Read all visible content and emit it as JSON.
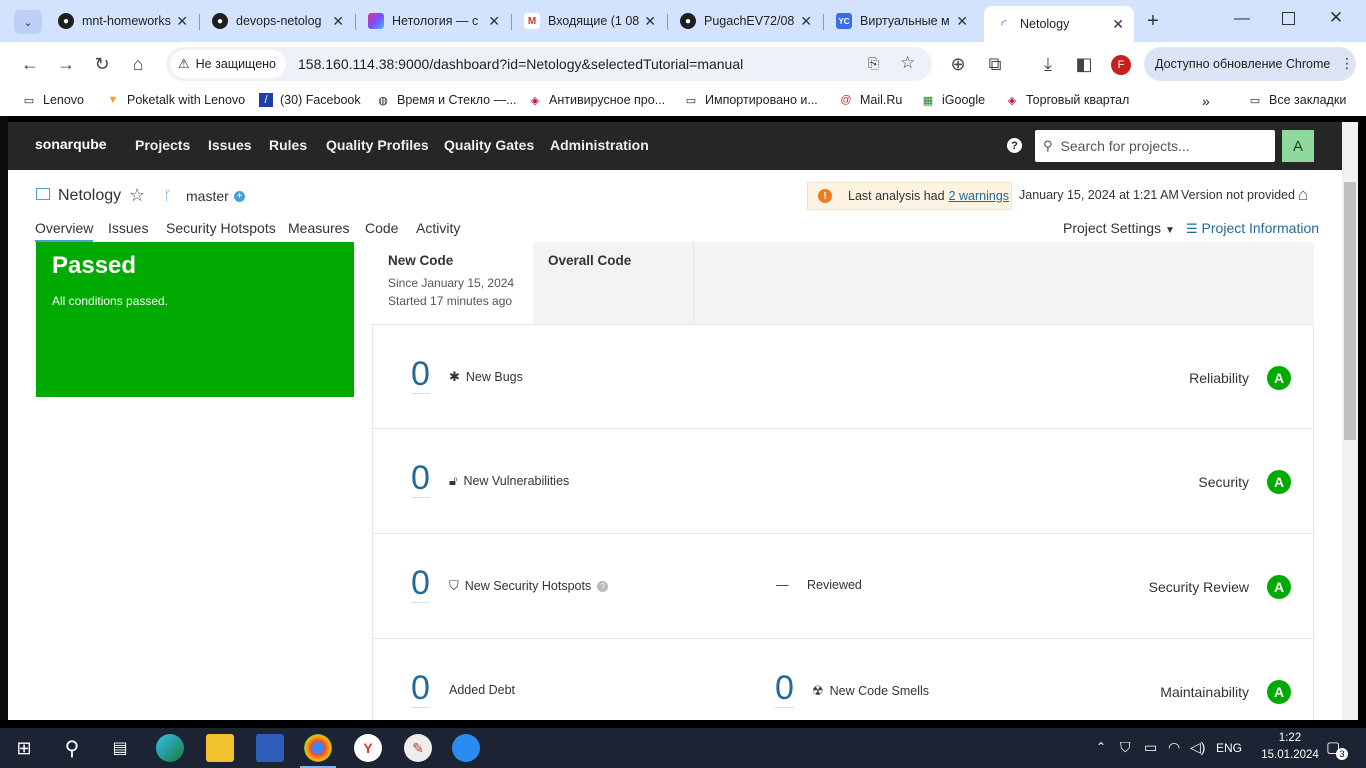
{
  "browser": {
    "tabs": [
      {
        "label": "mnt-homeworks",
        "icon": "github-icon"
      },
      {
        "label": "devops-netolog",
        "icon": "github-icon"
      },
      {
        "label": "Нетология — с",
        "icon": "netology-icon"
      },
      {
        "label": "Входящие (1 08",
        "icon": "gmail-icon"
      },
      {
        "label": "PugachEV72/08",
        "icon": "github-icon"
      },
      {
        "label": "Виртуальные м",
        "icon": "yandex-cloud-icon"
      },
      {
        "label": "Netology",
        "icon": "loading-icon"
      }
    ],
    "security_label": "Не защищено",
    "url": "158.160.114.38:9000/dashboard?id=Netology&selectedTutorial=manual",
    "update_label": "Доступно обновление Chrome",
    "profile_letter": "F",
    "bookmarks": [
      "Lenovo",
      "Poketalk with Lenovo",
      "(30) Facebook",
      "Время и Стекло —...",
      "Антивирусное про...",
      "Импортировано и...",
      "Mail.Ru",
      "iGoogle",
      "Торговый квартал"
    ],
    "all_bookmarks": "Все закладки"
  },
  "sonar": {
    "logo": "sonarqube",
    "nav": [
      "Projects",
      "Issues",
      "Rules",
      "Quality Profiles",
      "Quality Gates",
      "Administration"
    ],
    "search_placeholder": "Search for projects...",
    "avatar_letter": "A",
    "project": {
      "name": "Netology",
      "branch": "master",
      "warning_text": "Last analysis had",
      "warning_link": "2 warnings",
      "analysis_date": "January 15, 2024 at 1:21 AM",
      "version": "Version not provided"
    },
    "tabs": [
      "Overview",
      "Issues",
      "Security Hotspots",
      "Measures",
      "Code",
      "Activity"
    ],
    "project_settings": "Project Settings",
    "project_information": "Project Information",
    "quality_gate": {
      "status": "Passed",
      "message": "All conditions passed.",
      "color": "#00aa00"
    },
    "periods": {
      "new_code": "New Code",
      "since": "Since January 15, 2024",
      "started": "Started 17 minutes ago",
      "overall": "Overall Code"
    },
    "measures": {
      "bugs": {
        "value": "0",
        "label": "New Bugs",
        "category": "Reliability",
        "rating": "A"
      },
      "vulnerabilities": {
        "value": "0",
        "label": "New Vulnerabilities",
        "category": "Security",
        "rating": "A"
      },
      "hotspots": {
        "value": "0",
        "label": "New Security Hotspots",
        "reviewed_value": "—",
        "reviewed_label": "Reviewed",
        "category": "Security Review",
        "rating": "A"
      },
      "debt": {
        "value": "0",
        "label": "Added Debt",
        "smells_value": "0",
        "smells_label": "New Code Smells",
        "category": "Maintainability",
        "rating": "A"
      }
    }
  },
  "taskbar": {
    "lang": "ENG",
    "time": "1:22",
    "date": "15.01.2024",
    "notifications": "3"
  }
}
